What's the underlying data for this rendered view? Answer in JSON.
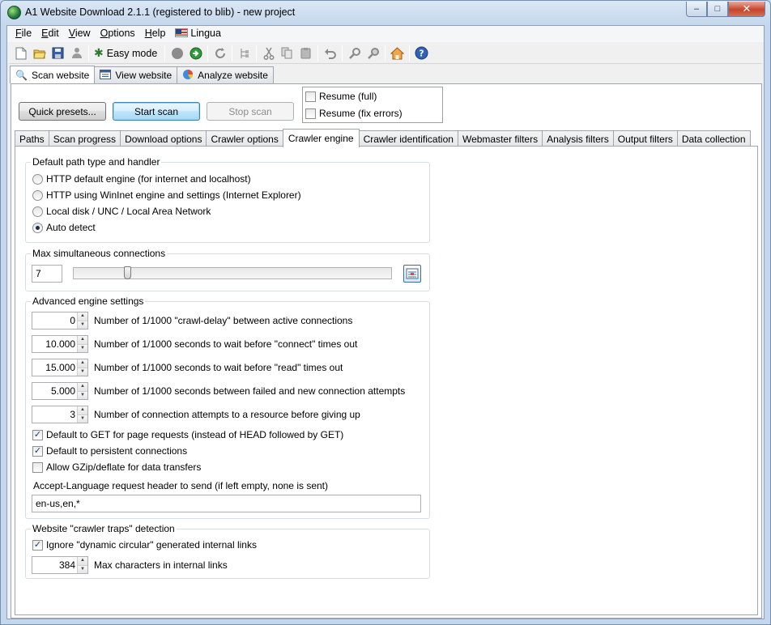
{
  "window": {
    "title": "A1 Website Download 2.1.1 (registered to blib) - new project",
    "buttons": {
      "minimize": "‒",
      "maximize": "□",
      "close": "✕"
    }
  },
  "menubar": {
    "items": [
      "File",
      "Edit",
      "View",
      "Options",
      "Help"
    ],
    "lingua": "Lingua"
  },
  "toolbar": {
    "easy_mode": "Easy mode"
  },
  "top_tabs": [
    "Scan website",
    "View website",
    "Analyze website"
  ],
  "scan": {
    "quick_presets": "Quick presets...",
    "start_scan": "Start scan",
    "stop_scan": "Stop scan",
    "resume_full": "Resume (full)",
    "resume_fix": "Resume (fix errors)"
  },
  "sub_tabs": [
    "Paths",
    "Scan progress",
    "Download options",
    "Crawler options",
    "Crawler engine",
    "Crawler identification",
    "Webmaster filters",
    "Analysis filters",
    "Output filters",
    "Data collection"
  ],
  "engine": {
    "path_group": {
      "title": "Default path type and handler",
      "options": [
        {
          "label": "HTTP default engine (for internet and localhost)",
          "selected": false
        },
        {
          "label": "HTTP using WinInet engine and settings (Internet Explorer)",
          "selected": false
        },
        {
          "label": "Local disk / UNC / Local Area Network",
          "selected": false
        },
        {
          "label": "Auto detect",
          "selected": true
        }
      ]
    },
    "max_conn": {
      "title": "Max simultaneous connections",
      "value": "7",
      "slider_fraction": 0.17
    },
    "advanced": {
      "title": "Advanced engine settings",
      "fields": [
        {
          "value": "0",
          "label": "Number of 1/1000 \"crawl-delay\" between active connections"
        },
        {
          "value": "10.000",
          "label": "Number of 1/1000 seconds to wait before \"connect\" times out"
        },
        {
          "value": "15.000",
          "label": "Number of 1/1000 seconds to wait before \"read\" times out"
        },
        {
          "value": "5.000",
          "label": "Number of 1/1000 seconds between failed and new connection attempts"
        },
        {
          "value": "3",
          "label": "Number of connection attempts to a resource before giving up"
        }
      ],
      "checks": [
        {
          "label": "Default to GET for page requests (instead of HEAD followed by GET)",
          "checked": true
        },
        {
          "label": "Default to persistent connections",
          "checked": true
        },
        {
          "label": "Allow GZip/deflate for data transfers",
          "checked": false
        }
      ],
      "accept_language_label": "Accept-Language request header to send (if left empty, none is sent)",
      "accept_language_value": "en-us,en,*"
    },
    "traps": {
      "title": "Website \"crawler traps\" detection",
      "ignore_label": "Ignore \"dynamic circular\" generated internal links",
      "ignore_checked": true,
      "max_chars_value": "384",
      "max_chars_label": "Max characters in internal links"
    }
  }
}
